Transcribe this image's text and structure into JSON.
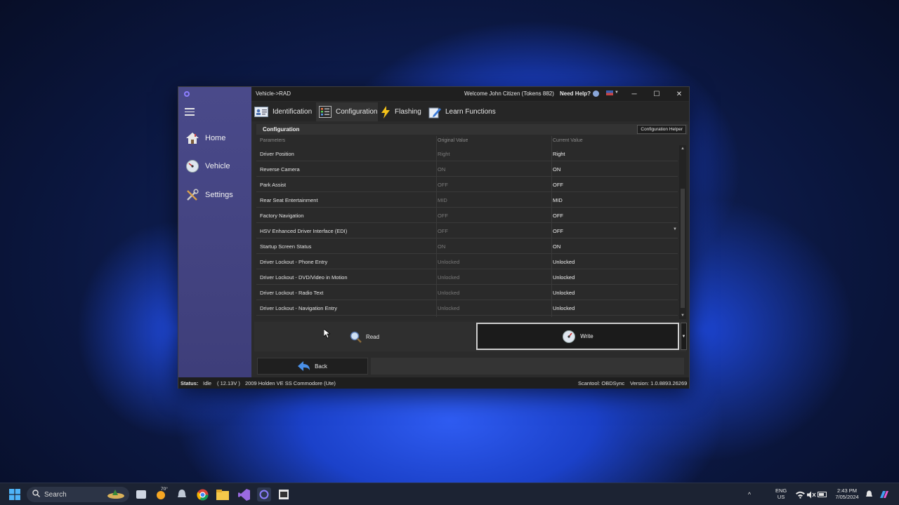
{
  "window": {
    "path": "Vehicle->RAD",
    "welcome": "Welcome John Citizen (Tokens 882)",
    "help": "Need Help?",
    "controls": {
      "minimize": "─",
      "maximize": "☐",
      "close": "✕"
    }
  },
  "sidebar": {
    "items": [
      {
        "label": "Home",
        "icon": "home-icon"
      },
      {
        "label": "Vehicle",
        "icon": "gauge-icon"
      },
      {
        "label": "Settings",
        "icon": "tools-icon"
      }
    ]
  },
  "tabs": [
    {
      "label": "Identification",
      "icon": "id-card-icon"
    },
    {
      "label": "Configuration",
      "icon": "list-icon",
      "active": true
    },
    {
      "label": "Flashing",
      "icon": "lightning-icon"
    },
    {
      "label": "Learn Functions",
      "icon": "pencil-icon"
    }
  ],
  "config": {
    "title": "Configuration",
    "helper_button": "Configuration Helper",
    "columns": [
      "Parameters",
      "Original Value",
      "Current Value"
    ],
    "rows": [
      {
        "param": "Driver Position",
        "original": "Right",
        "current": "Right"
      },
      {
        "param": "Reverse Camera",
        "original": "ON",
        "current": "ON"
      },
      {
        "param": "Park Assist",
        "original": "OFF",
        "current": "OFF"
      },
      {
        "param": "Rear Seat Entertainment",
        "original": "MID",
        "current": "MID"
      },
      {
        "param": "Factory Navigation",
        "original": "OFF",
        "current": "OFF"
      },
      {
        "param": "HSV Enhanced Driver Interface (EDI)",
        "original": "OFF",
        "current": "OFF",
        "dropdown": true
      },
      {
        "param": "Startup Screen Status",
        "original": "ON",
        "current": "ON"
      },
      {
        "param": "Driver Lockout - Phone Entry",
        "original": "Unlocked",
        "current": "Unlocked"
      },
      {
        "param": "Driver Lockout - DVD/Video in Motion",
        "original": "Unlocked",
        "current": "Unlocked"
      },
      {
        "param": "Driver Lockout - Radio Text",
        "original": "Unlocked",
        "current": "Unlocked"
      },
      {
        "param": "Driver Lockout - Navigation Entry",
        "original": "Unlocked",
        "current": "Unlocked"
      }
    ]
  },
  "actions": {
    "read": "Read",
    "write": "Write",
    "back": "Back"
  },
  "status": {
    "label": "Status:",
    "state": "Idle",
    "voltage": "( 12.13V )",
    "vehicle": "2009 Holden VE SS Commodore (Ute)",
    "scantool": "Scantool: OBDSync",
    "version": "Version: 1.0.8893.26269"
  },
  "taskbar": {
    "search_placeholder": "Search",
    "weather": "70°",
    "lang": "ENG",
    "region": "US",
    "time": "2:43 PM",
    "date": "7/05/2024"
  },
  "colors": {
    "accent": "#4a4a8a",
    "bg": "#2b2b2b"
  }
}
